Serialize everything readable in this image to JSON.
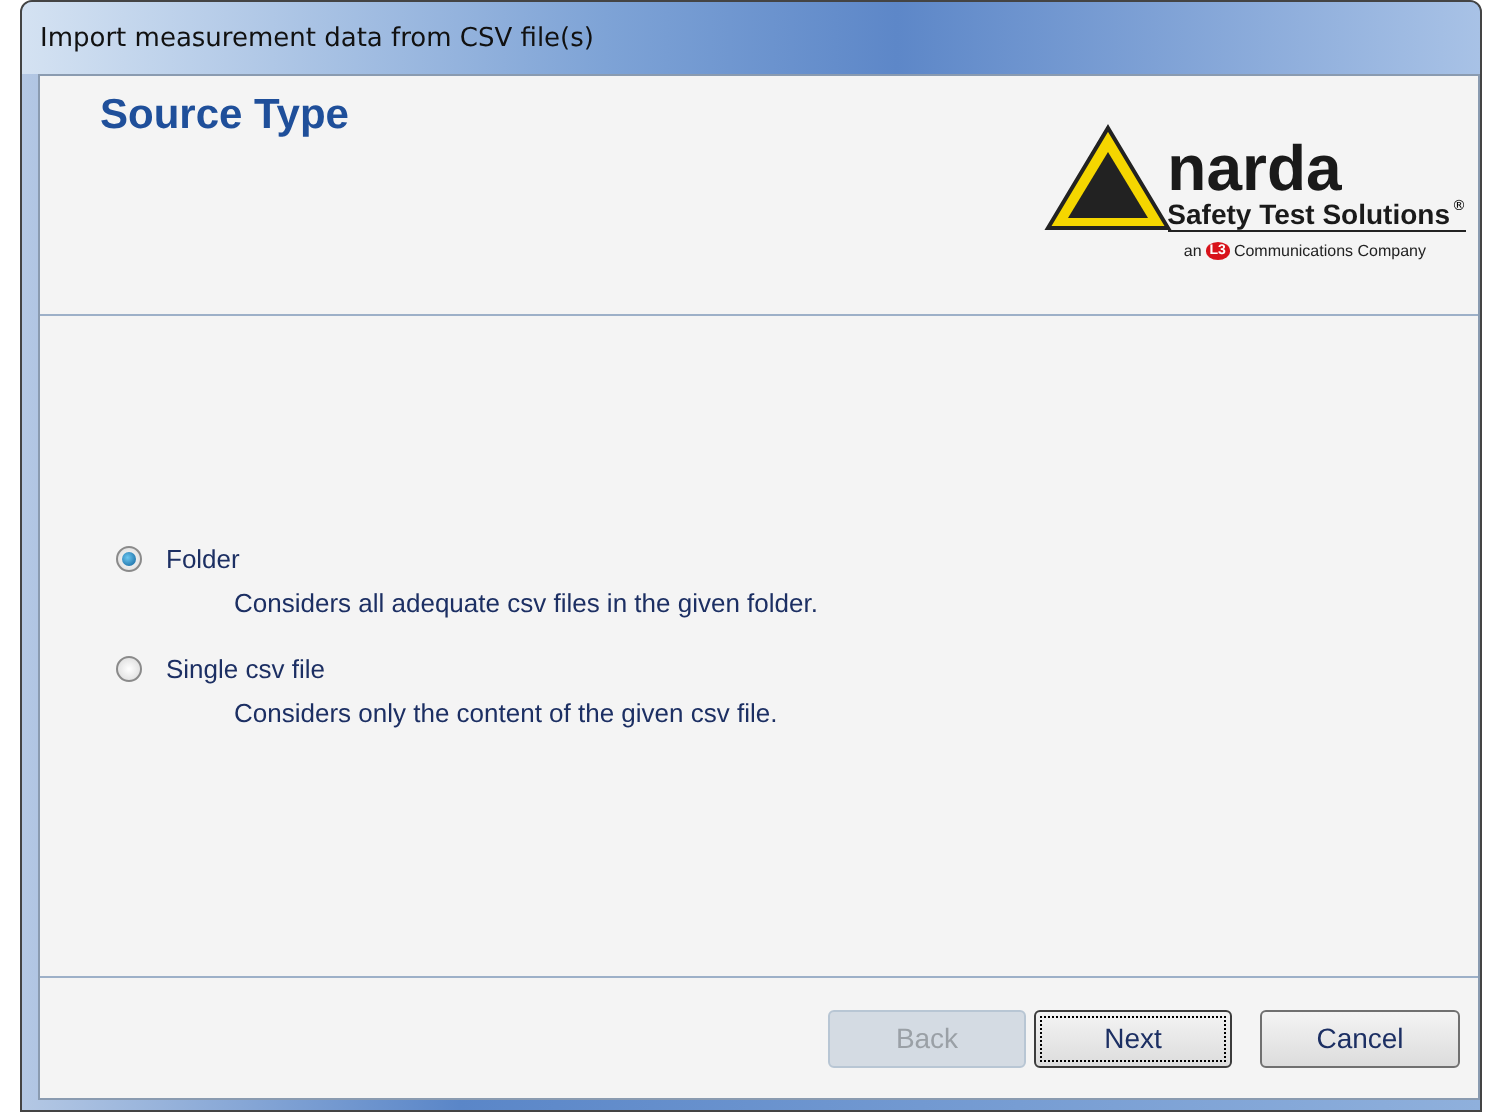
{
  "window": {
    "title": "Import measurement data from CSV file(s)"
  },
  "header": {
    "title": "Source Type",
    "logo": {
      "name": "narda",
      "tagline": "Safety Test Solutions",
      "registered": "®",
      "prefix": "an",
      "badge": "L3",
      "suffix": "Communications Company"
    }
  },
  "options": [
    {
      "label": "Folder",
      "description": "Considers all adequate csv files in the given folder.",
      "selected": true
    },
    {
      "label": "Single csv file",
      "description": "Considers only the content of the given csv file.",
      "selected": false
    }
  ],
  "buttons": [
    {
      "label": "Back",
      "disabled": true,
      "focused": false
    },
    {
      "label": "Next",
      "disabled": false,
      "focused": true
    },
    {
      "label": "Cancel",
      "disabled": false,
      "focused": false
    }
  ]
}
